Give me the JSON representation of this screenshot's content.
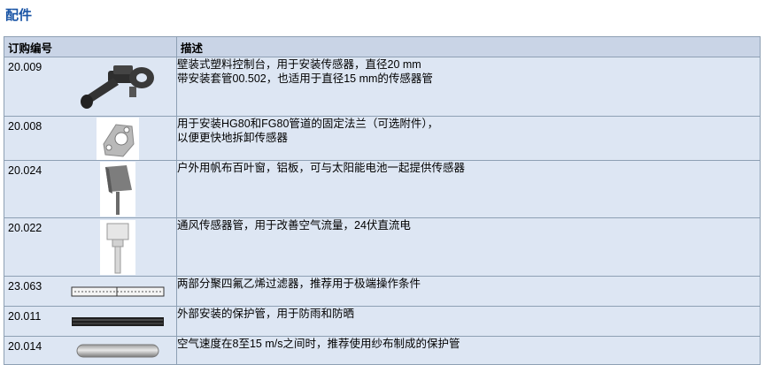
{
  "title": "配件",
  "headers": {
    "code": "订购编号",
    "desc": "描述"
  },
  "rows": [
    {
      "code": "20.009",
      "lines": [
        "壁装式塑料控制台，用于安装传感器，直径20 mm",
        "带安装套管00.502，也适用于直径15 mm的传感器管"
      ],
      "image": "wall-bracket-icon"
    },
    {
      "code": "20.008",
      "lines": [
        "用于安装HG80和FG80管道的固定法兰（可选附件），",
        "以便更快地拆卸传感器"
      ],
      "image": "mounting-flange-icon"
    },
    {
      "code": "20.024",
      "lines": [
        "户外用帆布百叶窗，铝板，可与太阳能电池一起提供传感器"
      ],
      "image": "louvre-shield-icon"
    },
    {
      "code": "20.022",
      "lines": [
        "通风传感器管，用于改善空气流量，24伏直流电"
      ],
      "image": "ventilated-tube-icon"
    },
    {
      "code": "23.063",
      "lines": [
        "两部分聚四氟乙烯过滤器，推荐用于极端操作条件"
      ],
      "image": "ptfe-filter-icon"
    },
    {
      "code": "20.011",
      "lines": [
        "外部安装的保护管，用于防雨和防晒"
      ],
      "image": "protection-tube-icon"
    },
    {
      "code": "20.014",
      "lines": [
        "空气速度在8至15 m/s之间时，推荐使用纱布制成的保护管"
      ],
      "image": "gauze-tube-icon"
    }
  ]
}
